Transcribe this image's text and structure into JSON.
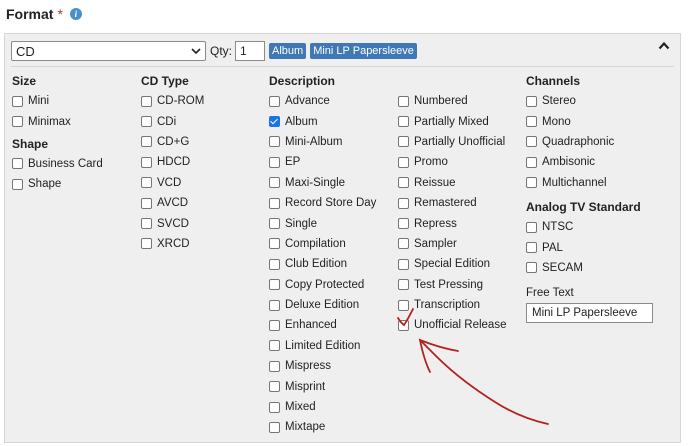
{
  "header": {
    "title": "Format",
    "required_mark": "*",
    "info_icon": "info-icon"
  },
  "toolbar": {
    "format_select": "CD",
    "qty_label": "Qty:",
    "qty_value": "1",
    "tags": [
      "Album",
      "Mini LP Papersleeve"
    ],
    "collapse_icon": "chevron-up-icon"
  },
  "columns": {
    "size": {
      "heading": "Size",
      "items": [
        {
          "label": "Mini",
          "checked": false
        },
        {
          "label": "Minimax",
          "checked": false
        }
      ]
    },
    "shape": {
      "heading": "Shape",
      "items": [
        {
          "label": "Business Card",
          "checked": false
        },
        {
          "label": "Shape",
          "checked": false
        }
      ]
    },
    "cd_type": {
      "heading": "CD Type",
      "items": [
        {
          "label": "CD-ROM",
          "checked": false
        },
        {
          "label": "CDi",
          "checked": false
        },
        {
          "label": "CD+G",
          "checked": false
        },
        {
          "label": "HDCD",
          "checked": false
        },
        {
          "label": "VCD",
          "checked": false
        },
        {
          "label": "AVCD",
          "checked": false
        },
        {
          "label": "SVCD",
          "checked": false
        },
        {
          "label": "XRCD",
          "checked": false
        }
      ]
    },
    "description": {
      "heading": "Description",
      "col1": [
        {
          "label": "Advance",
          "checked": false
        },
        {
          "label": "Album",
          "checked": true
        },
        {
          "label": "Mini-Album",
          "checked": false
        },
        {
          "label": "EP",
          "checked": false
        },
        {
          "label": "Maxi-Single",
          "checked": false
        },
        {
          "label": "Record Store Day",
          "checked": false
        },
        {
          "label": "Single",
          "checked": false
        },
        {
          "label": "Compilation",
          "checked": false
        },
        {
          "label": "Club Edition",
          "checked": false
        },
        {
          "label": "Copy Protected",
          "checked": false
        },
        {
          "label": "Deluxe Edition",
          "checked": false
        },
        {
          "label": "Enhanced",
          "checked": false
        },
        {
          "label": "Limited Edition",
          "checked": false
        },
        {
          "label": "Mispress",
          "checked": false
        },
        {
          "label": "Misprint",
          "checked": false
        },
        {
          "label": "Mixed",
          "checked": false
        },
        {
          "label": "Mixtape",
          "checked": false
        }
      ],
      "col2": [
        {
          "label": "Numbered",
          "checked": false
        },
        {
          "label": "Partially Mixed",
          "checked": false
        },
        {
          "label": "Partially Unofficial",
          "checked": false
        },
        {
          "label": "Promo",
          "checked": false
        },
        {
          "label": "Reissue",
          "checked": false
        },
        {
          "label": "Remastered",
          "checked": false
        },
        {
          "label": "Repress",
          "checked": false
        },
        {
          "label": "Sampler",
          "checked": false
        },
        {
          "label": "Special Edition",
          "checked": false
        },
        {
          "label": "Test Pressing",
          "checked": false
        },
        {
          "label": "Transcription",
          "checked": false
        },
        {
          "label": "Unofficial Release",
          "checked": false
        }
      ]
    },
    "channels": {
      "heading": "Channels",
      "items": [
        {
          "label": "Stereo",
          "checked": false
        },
        {
          "label": "Mono",
          "checked": false
        },
        {
          "label": "Quadraphonic",
          "checked": false
        },
        {
          "label": "Ambisonic",
          "checked": false
        },
        {
          "label": "Multichannel",
          "checked": false
        }
      ]
    },
    "analog_tv": {
      "heading": "Analog TV Standard",
      "items": [
        {
          "label": "NTSC",
          "checked": false
        },
        {
          "label": "PAL",
          "checked": false
        },
        {
          "label": "SECAM",
          "checked": false
        }
      ]
    },
    "free_text": {
      "label": "Free Text",
      "value": "Mini LP Papersleeve"
    }
  },
  "annotation": {
    "color": "#b22222"
  }
}
